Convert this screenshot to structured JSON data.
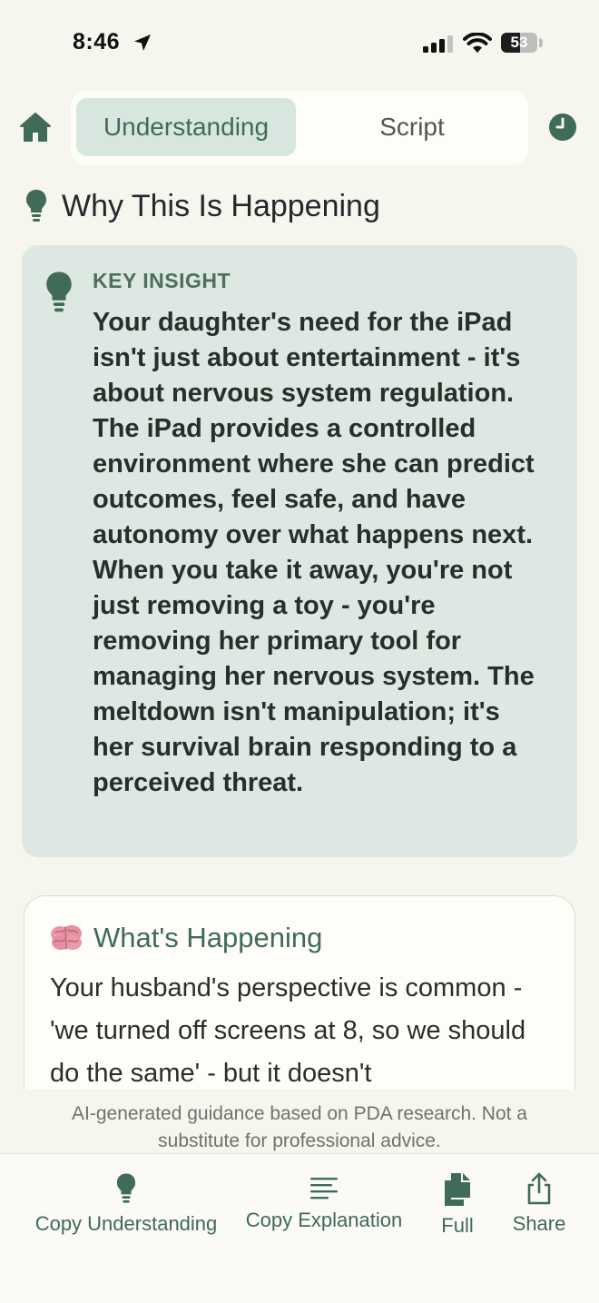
{
  "status_bar": {
    "time": "8:46",
    "battery": "53",
    "battery_level": 0.53
  },
  "nav": {
    "tabs": [
      {
        "label": "Understanding",
        "active": true
      },
      {
        "label": "Script",
        "active": false
      }
    ]
  },
  "section": {
    "title": "Why This Is Happening"
  },
  "insight": {
    "label": "KEY INSIGHT",
    "text": "Your daughter's need for the iPad isn't just about entertainment - it's about nervous system regulation. The iPad provides a controlled environment where she can predict outcomes, feel safe, and have autonomy over what happens next. When you take it away, you're not just removing a toy - you're removing her primary tool for managing her nervous system. The meltdown isn't manipulation; it's her survival brain responding to a perceived threat."
  },
  "happening": {
    "title": "What's Happening",
    "text": "Your husband's perspective is common - 'we turned off screens at 8, so we should do the same' - but it doesn't"
  },
  "disclaimer": {
    "line1": "AI-generated guidance based on PDA research. Not a",
    "line2": "substitute for professional advice."
  },
  "actions": {
    "copy_understanding": "Copy Understanding",
    "copy_explanation": "Copy Explanation",
    "full": "Full",
    "share": "Share"
  },
  "colors": {
    "accent": "#3f6b58",
    "tab_active_bg": "#d7e7e0",
    "card_bg": "#dce8e1",
    "page_bg": "#f6f5ee"
  },
  "icons": [
    "location-arrow-icon",
    "signal-icon",
    "wifi-icon",
    "battery-icon",
    "home-icon",
    "clock-icon",
    "lightbulb-icon",
    "brain-icon",
    "text-lines-icon",
    "documents-icon",
    "share-icon"
  ]
}
